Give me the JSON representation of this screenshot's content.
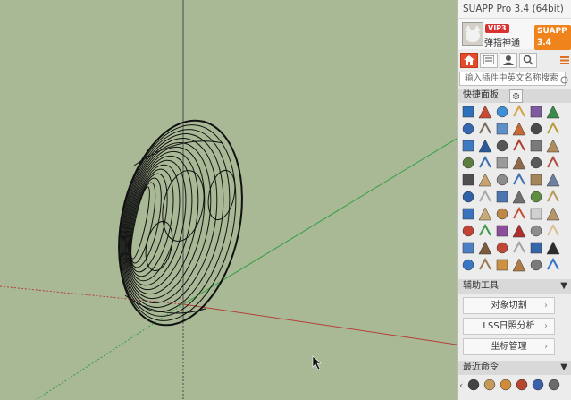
{
  "app": {
    "title": "SUAPP Pro 3.4 (64bit)",
    "version_badge": "SUAPP 3.4"
  },
  "user": {
    "name": "弹指神通",
    "vip_badge": "VIP3"
  },
  "tabs": [
    "home-icon",
    "list-icon",
    "user-icon",
    "search-icon"
  ],
  "search": {
    "placeholder": "输入插件中英文名称搜索"
  },
  "sections": {
    "quick_panel": {
      "title": "快捷面板"
    },
    "helper_tools": {
      "title": "辅助工具",
      "toggle": "▼"
    },
    "recent": {
      "title": "最近命令",
      "toggle": "▼"
    }
  },
  "helper_items": [
    {
      "label": "对象切割",
      "arrow": "›"
    },
    {
      "label": "LSS日照分析",
      "arrow": "›"
    },
    {
      "label": "坐标管理",
      "arrow": "›"
    }
  ],
  "tool_icons": [
    "#2d6fb8",
    "#c94b35",
    "#3f8fd6",
    "#d6a144",
    "#7e5a9e",
    "#3a8c4a",
    "#3567b0",
    "#7b6d5e",
    "#5e90c8",
    "#c46a36",
    "#4a4a4a",
    "#b89b3a",
    "#3f79c2",
    "#2b5a99",
    "#565656",
    "#aa4131",
    "#7a7a7a",
    "#ae8c5c",
    "#5d7c3f",
    "#3b6fb3",
    "#9b9b9b",
    "#8f6a4a",
    "#5a5a5a",
    "#b24c3e",
    "#4f4f4f",
    "#c7a46e",
    "#8c8c8c",
    "#3c6fb4",
    "#a5855c",
    "#6c7f9e",
    "#2f63a6",
    "#a9a9a9",
    "#4d76b0",
    "#6f6f6f",
    "#5e8e3f",
    "#b89a5a",
    "#3a72c0",
    "#c9ab78",
    "#bd8848",
    "#c44f34",
    "#d0d0d0",
    "#b79567",
    "#c24234",
    "#3d9a4a",
    "#8e4c9c",
    "#b02e2e",
    "#8d8d8d",
    "#d8c094",
    "#4c7fc3",
    "#7b5c3d",
    "#c04836",
    "#a2a2a2",
    "#3566a8",
    "#2d2d2d",
    "#3977c5",
    "#9a7a55",
    "#cc9142",
    "#b07c46",
    "#7a7a7a",
    "#2f74c6"
  ],
  "recent_icons": [
    "#444444",
    "#c49a5a",
    "#d08a3a",
    "#b5472f",
    "#3b5fa8",
    "#6a6a6a"
  ],
  "icons": {
    "settings": "gear-icon",
    "refresh": "refresh-icon",
    "more": "menu-icon"
  },
  "colors": {
    "viewport_bg": "#a9b895",
    "axis_red": "#b5403a",
    "axis_green": "#3aa84a",
    "accent_orange": "#f0841c"
  }
}
